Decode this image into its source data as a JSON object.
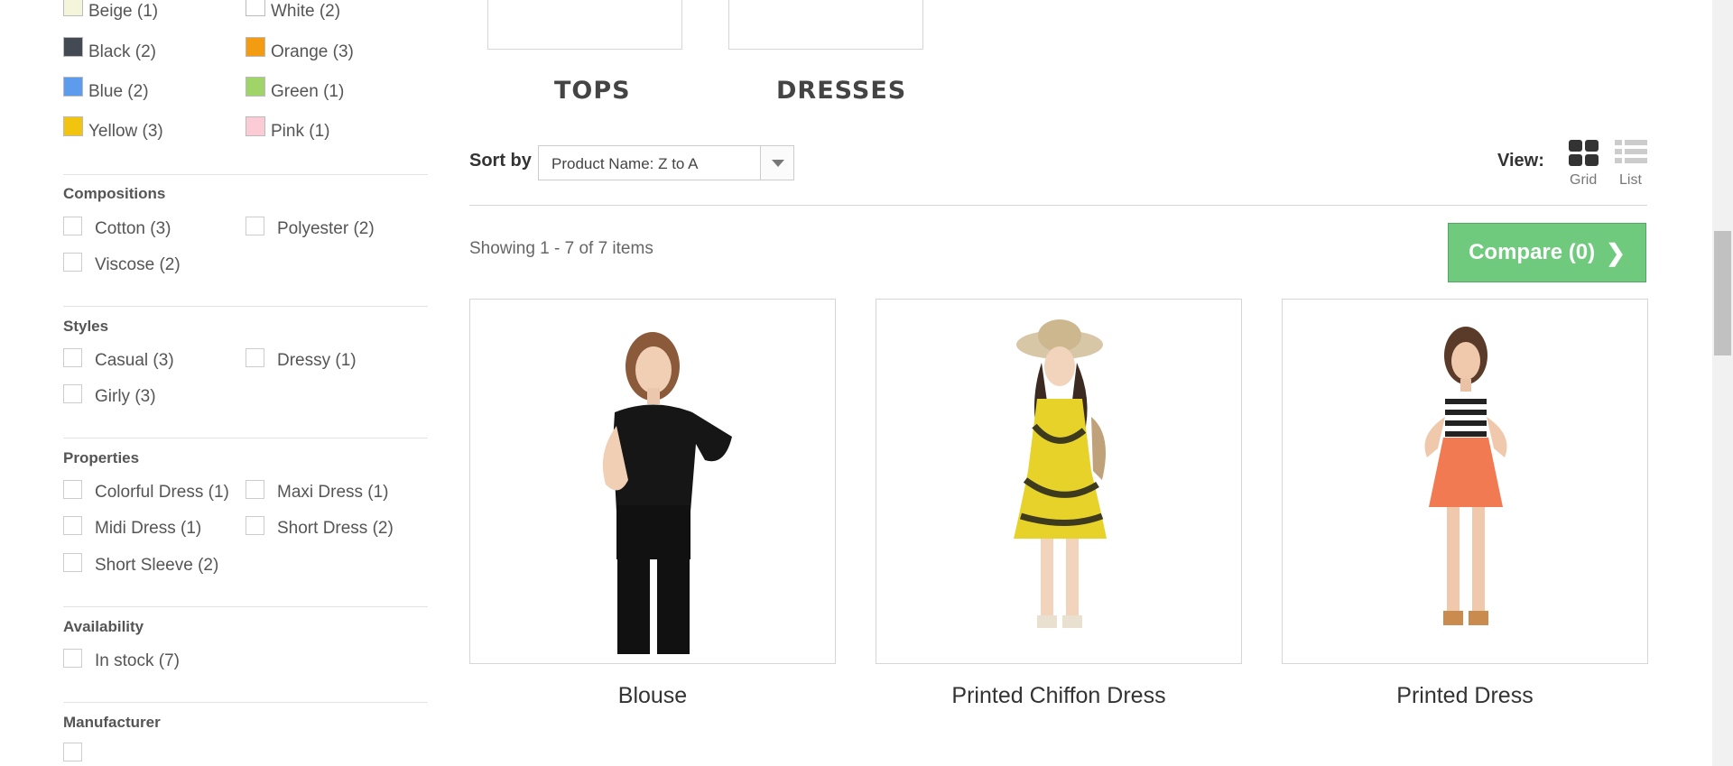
{
  "filters": {
    "colors": [
      {
        "label": "Beige (1)",
        "color": "#f5f5dc"
      },
      {
        "label": "White (2)",
        "color": "#ffffff"
      },
      {
        "label": "Black (2)",
        "color": "#434a54"
      },
      {
        "label": "Orange (3)",
        "color": "#f39c11"
      },
      {
        "label": "Blue (2)",
        "color": "#5d9cec"
      },
      {
        "label": "Green (1)",
        "color": "#a0d468"
      },
      {
        "label": "Yellow (3)",
        "color": "#f1c40f"
      },
      {
        "label": "Pink (1)",
        "color": "#fcccd6"
      }
    ],
    "compositions": {
      "title": "Compositions",
      "items": [
        "Cotton (3)",
        "Polyester (2)",
        "Viscose (2)"
      ]
    },
    "styles": {
      "title": "Styles",
      "items": [
        "Casual (3)",
        "Dressy (1)",
        "Girly (3)"
      ]
    },
    "properties": {
      "title": "Properties",
      "items": [
        "Colorful Dress (1)",
        "Maxi Dress (1)",
        "Midi Dress (1)",
        "Short Dress (2)",
        "Short Sleeve (2)"
      ]
    },
    "availability": {
      "title": "Availability",
      "items": [
        "In stock (7)"
      ]
    },
    "manufacturer": {
      "title": "Manufacturer"
    }
  },
  "subcategories": [
    "TOPS",
    "DRESSES"
  ],
  "sort": {
    "label": "Sort by",
    "value": "Product Name: Z to A"
  },
  "view": {
    "label": "View:",
    "grid": "Grid",
    "list": "List"
  },
  "showing": "Showing 1 - 7 of 7 items",
  "compare": {
    "label": "Compare (0)"
  },
  "products": [
    {
      "name": "Blouse"
    },
    {
      "name": "Printed Chiffon Dress"
    },
    {
      "name": "Printed Dress"
    }
  ]
}
